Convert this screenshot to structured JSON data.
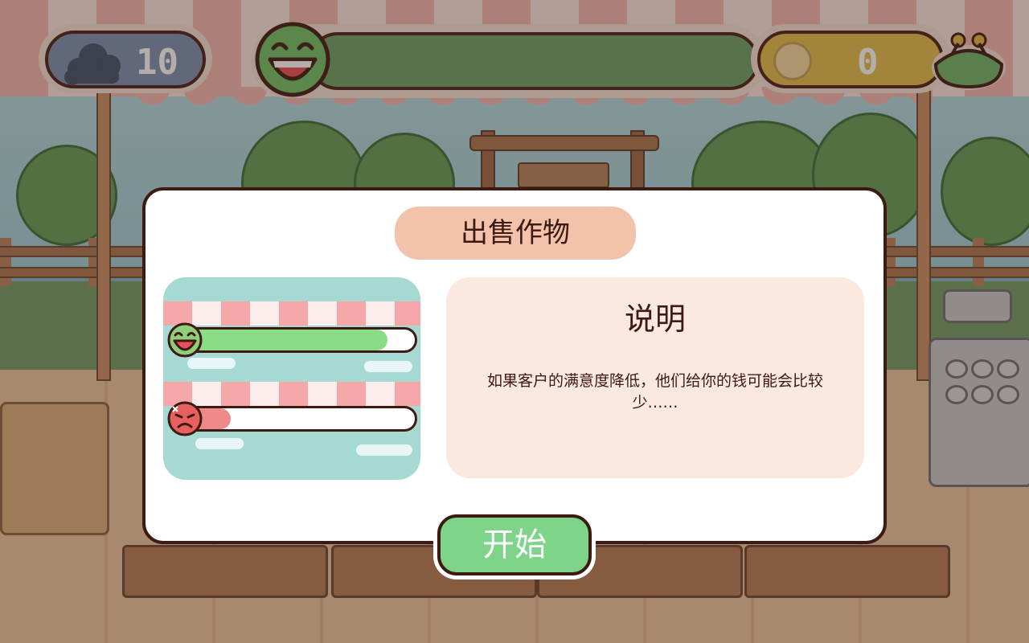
{
  "hud": {
    "cloud_count": "10",
    "coin_count": "0",
    "icons": {
      "cloud": "cloud-icon",
      "mood": "happy-face-icon",
      "coin": "coin-icon",
      "purse": "purse-icon"
    },
    "mood_level": 1.0
  },
  "dialog": {
    "title": "出售作物",
    "description_title": "说明",
    "description_text": "如果客户的满意度降低，他们给你的钱可能会比较少……",
    "start_label": "开始",
    "preview": {
      "happy_bar_level": 0.88,
      "angry_bar_level": 0.2
    }
  },
  "colors": {
    "accent_green": "#7ed58a",
    "title_pill": "#f3c2ab",
    "desc_panel": "#fbe8de",
    "outline": "#3d1a12",
    "coin_pill": "#e0bd4c",
    "cloud_pill": "#7790b4",
    "mood_bar": "#6aa06a"
  }
}
